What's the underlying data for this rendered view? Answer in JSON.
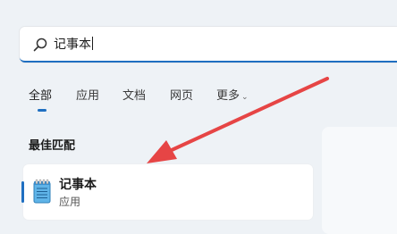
{
  "search": {
    "value": "记事本"
  },
  "tabs": [
    {
      "label": "全部",
      "active": true
    },
    {
      "label": "应用"
    },
    {
      "label": "文档"
    },
    {
      "label": "网页"
    },
    {
      "label": "更多"
    }
  ],
  "section": {
    "best_match_title": "最佳匹配"
  },
  "best_match": {
    "name": "记事本",
    "type": "应用",
    "icon": "notepad-icon"
  },
  "colors": {
    "accent": "#1f6fc1",
    "arrow": "#e64545"
  }
}
